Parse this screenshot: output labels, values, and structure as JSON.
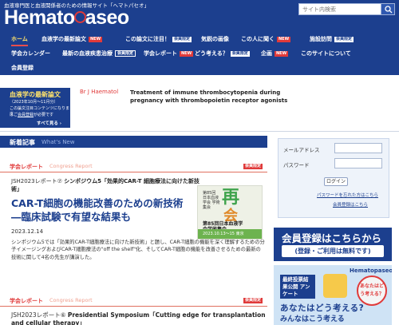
{
  "header": {
    "tagline": "血液専門医と血液関係者のための情報サイト「ヘマトパセオ」",
    "logo": "Hematopaseo",
    "search_placeholder": "サイト内検索"
  },
  "nav": {
    "home": "ホーム",
    "latest_papers": "血液学の最新論文",
    "latest_papers_badge": "NEW",
    "featured_paper": "この論文に注目！",
    "featured_paper_badge": "会員限定",
    "image": "気鋭の画像",
    "interview": "この人に聞く",
    "interview_badge": "NEW",
    "facility": "施設訪問",
    "facility_badge": "会員限定",
    "conference_info": "学会カレンダー",
    "treatment_trends": "最新の血液疾患治療",
    "treatment_trends_badge": "会員限定",
    "report": "学会レポート",
    "report_badge": "NEW",
    "opinion": "どう考える？",
    "opinion_badge": "会員限定",
    "project": "企画",
    "project_badge": "NEW",
    "about": "このサイトについて",
    "register": "会員登録"
  },
  "ticker": {
    "label": "血液学の最新論文",
    "period": "（2023年10月〜11月分）",
    "note1": "この論文注目コンテンツになります",
    "note2_pre": "はご",
    "note2_link": "会員登録",
    "note2_post": "が必要です",
    "more": "すべて見る ›",
    "journal": "Br J Haematol",
    "title": "Treatment of immune thrombocytopenia during pregnancy with thrombopoietin receptor agonists"
  },
  "news": {
    "heading": "新着記事",
    "heading_en": "What's New",
    "category": "学会レポート",
    "category_en": "Congress Report",
    "member_badge": "会員限定",
    "kicker_prefix": "JSH2023レポート⑦",
    "kicker_bold": "シンポジウム5「効果的CAR-T 細胞療法に向けた新技術」",
    "title": "CAR-T細胞の機能改善のための新技術―臨床試験で有望な結果も",
    "date": "2023.12.14",
    "body": "シンポジウム5では「効果的CAR-T細胞療法に向けた新技術」と題し、CAR-T細胞の機能を深く理解するための分子イメージングおよびCAR-T細胞療法の\"off the shelf\"化、そしてCAR-T細胞の機能を改善させるための最新の技術に関して4名の先生が講演した。",
    "category2": "学会レポート",
    "category2_en": "Congress Report",
    "kicker2_prefix": "JSH2023レポート⑥",
    "kicker2_bold": "Presidential Symposium「Cutting edge for transplantation and cellular therapy」"
  },
  "thumbnail": {
    "left": "第85回 日本血液学会 学術集会",
    "title": "第85回日本血液学会学術集会",
    "big": "再",
    "big2": "会",
    "footer": "2023.10.13〜15 東京"
  },
  "login": {
    "email_label": "メールアドレス",
    "password_label": "パスワード",
    "button": "ログイン",
    "forgot_link": "パスワードを忘れた方はこちら",
    "register_link": "会員登録はこちら"
  },
  "register_banner": {
    "line1": "会員登録はこちらから",
    "line2": "(登録・ご利用は無料です)"
  },
  "survey_banner": {
    "logo": "Hematopaseo",
    "label": "最終投票結果公開 アンケート",
    "circle": "あなたはどう考える？",
    "line1": "あなたはどう考える?",
    "line2": "みんなはこう考える"
  },
  "colors": {
    "brand_navy": "#1c3f8e",
    "accent_red": "#e03a3a",
    "highlight_yellow": "#ffe36b"
  }
}
